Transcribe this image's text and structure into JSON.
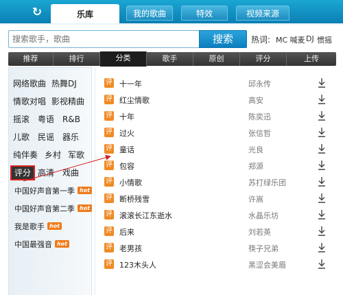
{
  "topbar": {
    "tabs": [
      "乐库",
      "我的歌曲",
      "特效",
      "视频来源"
    ],
    "active_tab": "乐库"
  },
  "search": {
    "placeholder": "搜索歌手，歌曲",
    "button_label": "搜索",
    "hot_label": "热词:",
    "hot_words": [
      "MC 喊麦",
      "DJ",
      "惯摇"
    ]
  },
  "category_nav": {
    "items": [
      "推荐",
      "排行",
      "分类",
      "歌手",
      "原创",
      "评分",
      "上传"
    ],
    "active": "分类"
  },
  "sidebar": {
    "tags": [
      [
        "网络歌曲",
        "热舞DJ"
      ],
      [
        "情歌对唱",
        "影视精曲"
      ],
      [
        "摇滚",
        "粤语",
        "R&B"
      ],
      [
        "儿歌",
        "民谣",
        "器乐"
      ],
      [
        "纯伴奏",
        "乡村",
        "军歌"
      ],
      [
        "评分",
        "高清",
        "戏曲"
      ]
    ],
    "selected_tag": "评分",
    "specials": [
      {
        "label": "中国好声音第一季",
        "badge": "hot"
      },
      {
        "label": "中国好声音第二季",
        "badge": "hot"
      },
      {
        "label": "我是歌手",
        "badge": "hot"
      },
      {
        "label": "中国最强音",
        "badge": "hot"
      }
    ]
  },
  "songs": {
    "badge": "评",
    "rows": [
      {
        "title": "十一年",
        "artist": "邱永传"
      },
      {
        "title": "红尘情歌",
        "artist": "高安"
      },
      {
        "title": "十年",
        "artist": "陈奕迅"
      },
      {
        "title": "过火",
        "artist": "张信哲"
      },
      {
        "title": "童话",
        "artist": "光良"
      },
      {
        "title": "包容",
        "artist": "郑源"
      },
      {
        "title": "小情歌",
        "artist": "苏打绿乐团"
      },
      {
        "title": "断桥残雪",
        "artist": "许嵩"
      },
      {
        "title": "滚滚长江东逝水",
        "artist": "水晶乐坊"
      },
      {
        "title": "后来",
        "artist": "刘若英"
      },
      {
        "title": "老男孩",
        "artist": "筷子兄弟"
      },
      {
        "title": "123木头人",
        "artist": "黑涩会美眉"
      }
    ]
  },
  "colors": {
    "topbar": "#0b7fb3",
    "accent_orange": "#f08a24",
    "annotation_red": "#d22222",
    "nav_dark": "#333333"
  }
}
